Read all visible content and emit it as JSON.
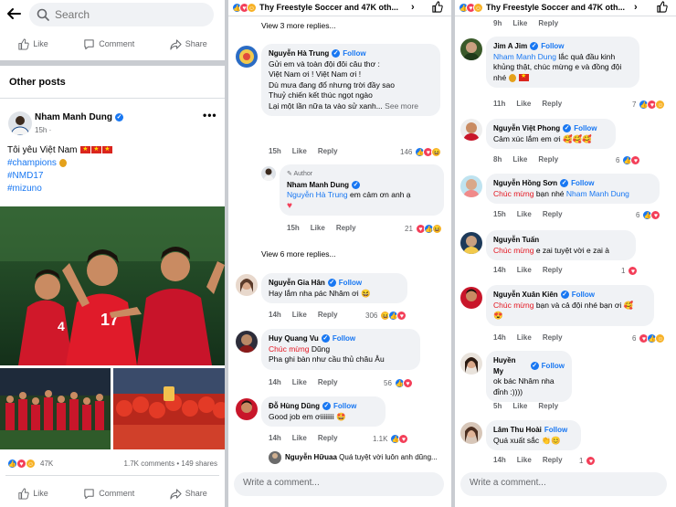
{
  "colors": {
    "accent": "#1877f2",
    "muted": "#65676b",
    "mention_red": "#e4151f",
    "bubble": "#f0f2f5"
  },
  "panel1": {
    "search_placeholder": "Search",
    "actions_top": {
      "like": "Like",
      "comment": "Comment",
      "share": "Share"
    },
    "section_title": "Other posts",
    "post": {
      "author": "Nham Manh Dung",
      "time": "15h",
      "more": "•••",
      "text": "Tôi yêu Việt Nam",
      "tags": [
        "#champions",
        "#NMD17",
        "#mizuno"
      ],
      "reaction_count": "47K",
      "comments": "1.7K comments",
      "shares": "149 shares",
      "stats_sep": "•",
      "jersey_left": "4",
      "jersey_mid": "17"
    },
    "actions_bottom": {
      "like": "Like",
      "comment": "Comment",
      "share": "Share"
    }
  },
  "panel2": {
    "title": "Thy Freestyle Soccer and 47K oth...",
    "view_more_1": "View 3 more replies...",
    "view_more_2": "View 6 more replies...",
    "comments": [
      {
        "name": "Nguyễn Hà Trung",
        "follow": "Follow",
        "lines": [
          "Gửi em và toàn đội đôi câu thơ :",
          "Việt Nam ơi ! Việt Nam ơi !",
          "Dù mưa đang đổ nhưng trời đầy sao",
          "Thuỷ chiến kết thúc ngọt ngào",
          "Lại một lần nữa ta vào sử xanh..."
        ],
        "see_more": "See more",
        "time": "15h",
        "like": "Like",
        "reply": "Reply",
        "reacts": "146"
      },
      {
        "author_badge": "Author",
        "name": "Nham Manh Dung",
        "mention": "Nguyễn Hà Trung",
        "text": "em cảm ơn anh ạ",
        "time": "15h",
        "like": "Like",
        "reply": "Reply",
        "reacts": "21"
      },
      {
        "name": "Nguyễn Gia Hân",
        "follow": "Follow",
        "text": "Hay lắm nha pác Nhâm ơi",
        "time": "14h",
        "like": "Like",
        "reply": "Reply",
        "reacts": "306"
      },
      {
        "name": "Huy Quang Vu",
        "follow": "Follow",
        "mention": "Chúc mừng",
        "mention_rest": "Dũng",
        "text": "Pha ghi bàn như cầu thủ châu Âu",
        "time": "14h",
        "like": "Like",
        "reply": "Reply",
        "reacts": "56"
      },
      {
        "name": "Đỗ Hùng Dũng",
        "follow": "Follow",
        "text": "Good job em ơiiiiiiii",
        "time": "14h",
        "like": "Like",
        "reply": "Reply",
        "reacts": "1.1K"
      },
      {
        "name": "Nguyễn Hữuaa",
        "text": "Quá tuyệt vời luôn anh dũng..."
      }
    ],
    "write_placeholder": "Write a comment..."
  },
  "panel3": {
    "title": "Thy Freestyle Soccer and 47K oth...",
    "top_meta": {
      "time": "9h",
      "like": "Like",
      "reply": "Reply"
    },
    "comments": [
      {
        "name": "Jim A Jim",
        "follow": "Follow",
        "mention": "Nham Manh Dung",
        "text": "lắc quả đầu kinh khủng thật, chúc mừng e và đồng đội nhé",
        "time": "11h",
        "like": "Like",
        "reply": "Reply",
        "reacts": "7"
      },
      {
        "name": "Nguyễn Việt Phong",
        "follow": "Follow",
        "text": "Cảm xúc lắm em ơi",
        "time": "8h",
        "like": "Like",
        "reply": "Reply",
        "reacts": "6"
      },
      {
        "name": "Nguyễn Hồng Sơn",
        "follow": "Follow",
        "mention_red": "Chúc mừng",
        "text": "bạn nhé",
        "mention": "Nham Manh Dung",
        "time": "15h",
        "like": "Like",
        "reply": "Reply",
        "reacts": "6"
      },
      {
        "name": "Nguyễn Tuấn",
        "mention_red": "Chúc mừng",
        "text": "e zai tuyệt vời e zai à",
        "time": "14h",
        "like": "Like",
        "reply": "Reply",
        "reacts": "1"
      },
      {
        "name": "Nguyễn Xuân Kiên",
        "follow": "Follow",
        "mention_red": "Chúc mừng",
        "text": "bạn và cả đội nhé bạn ơi",
        "time": "14h",
        "like": "Like",
        "reply": "Reply",
        "reacts": "6"
      },
      {
        "name": "Huyền My",
        "follow": "Follow",
        "lines": [
          "ok bác Nhâm nha",
          "đỉnh :))))"
        ],
        "time": "5h",
        "like": "Like",
        "reply": "Reply"
      },
      {
        "name": "Lâm Thu Hoài",
        "follow": "Follow",
        "text": "Quá xuất sắc",
        "time": "14h",
        "like": "Like",
        "reply": "Reply",
        "reacts": "1"
      }
    ],
    "write_placeholder": "Write a comment..."
  }
}
